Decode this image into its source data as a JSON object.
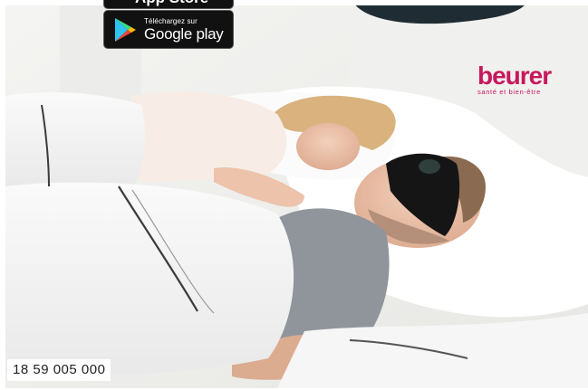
{
  "badges": {
    "appstore_label": "App Store",
    "googleplay_small": "Téléchargez sur",
    "googleplay_large": "Google play"
  },
  "logo": {
    "word": "beurer",
    "tagline": "santé et bien-être"
  },
  "footer": {
    "phone": "18 59 005 000"
  },
  "colors": {
    "brand": "#c6195d",
    "badge_bg": "#111111"
  },
  "icons": [
    "apple-icon",
    "google-play-icon"
  ]
}
